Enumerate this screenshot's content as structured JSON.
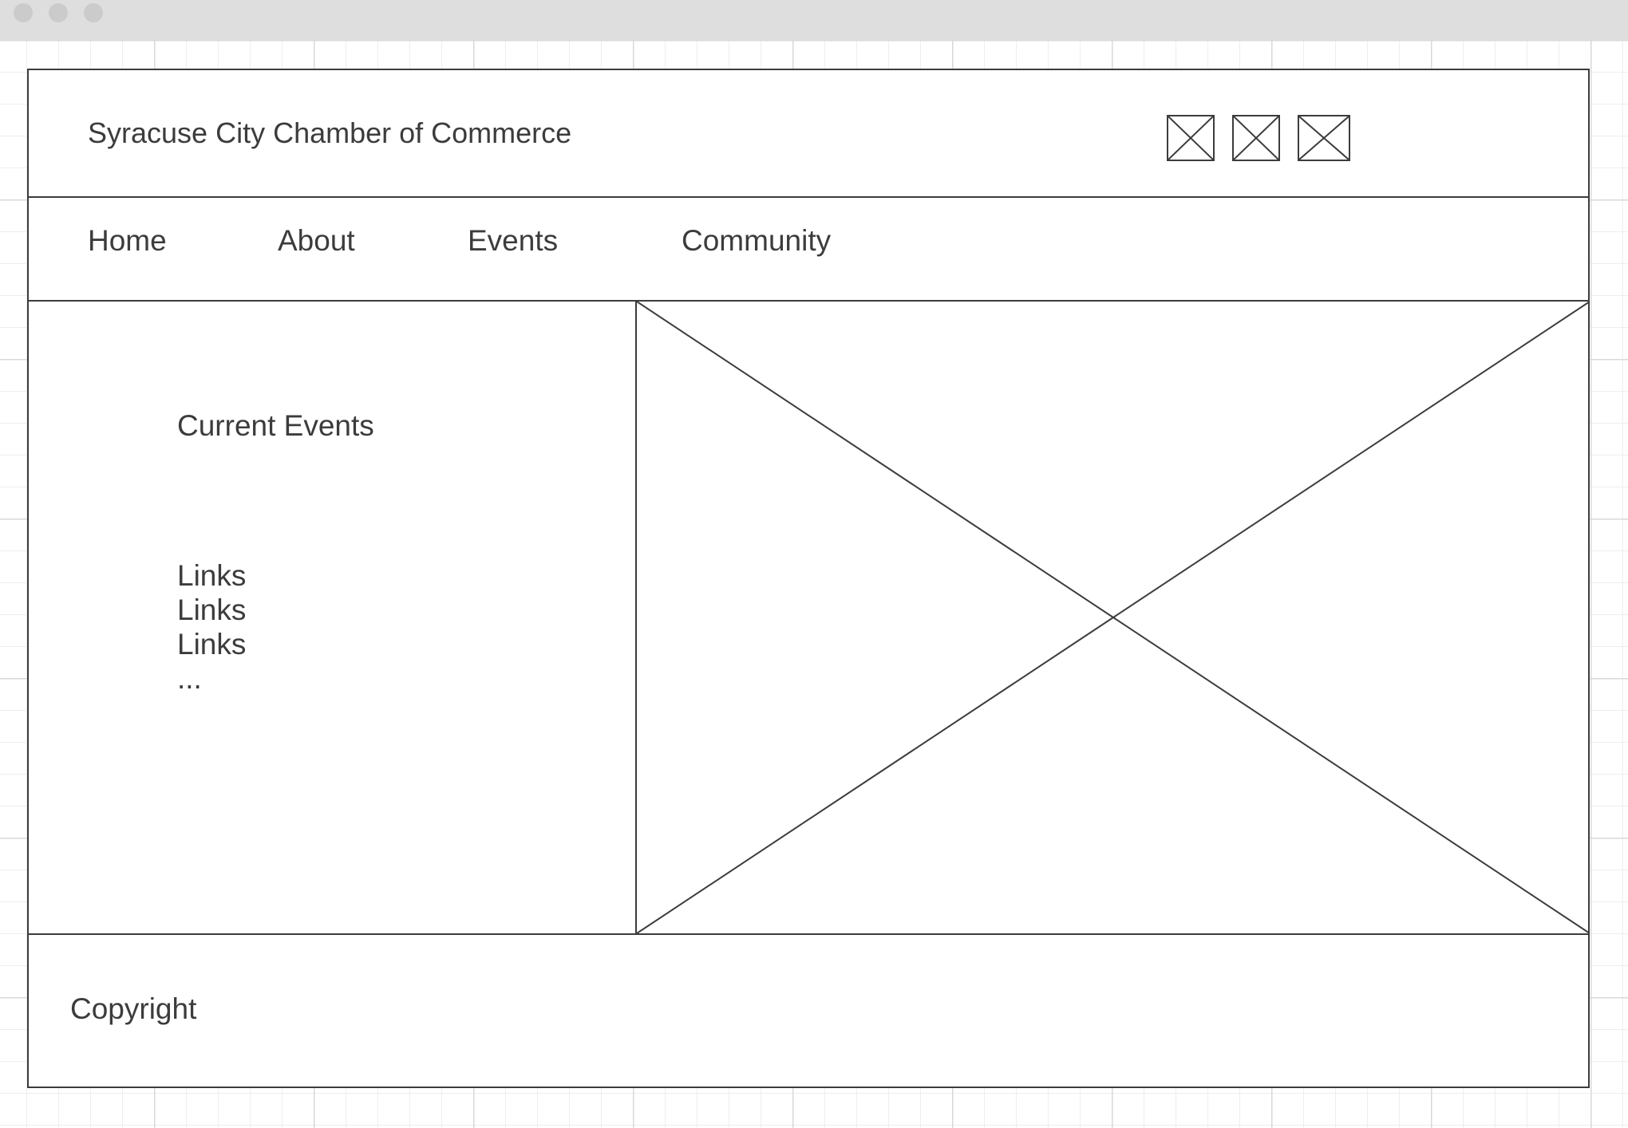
{
  "header": {
    "title": "Syracuse City Chamber of Commerce",
    "icons": [
      "image-placeholder-icon",
      "image-placeholder-icon",
      "image-placeholder-icon"
    ]
  },
  "nav": {
    "items": [
      {
        "label": "Home"
      },
      {
        "label": "About"
      },
      {
        "label": "Events"
      },
      {
        "label": "Community"
      }
    ]
  },
  "sidebar": {
    "heading": "Current Events",
    "links": [
      "Links",
      "Links",
      "Links"
    ],
    "more": "..."
  },
  "main": {
    "image": "image-placeholder-icon"
  },
  "footer": {
    "text": "Copyright"
  },
  "colors": {
    "line": "#3c3c3c",
    "text": "#3c3c3c",
    "titlebar": "#dedede",
    "grid": "#eeeeee"
  }
}
